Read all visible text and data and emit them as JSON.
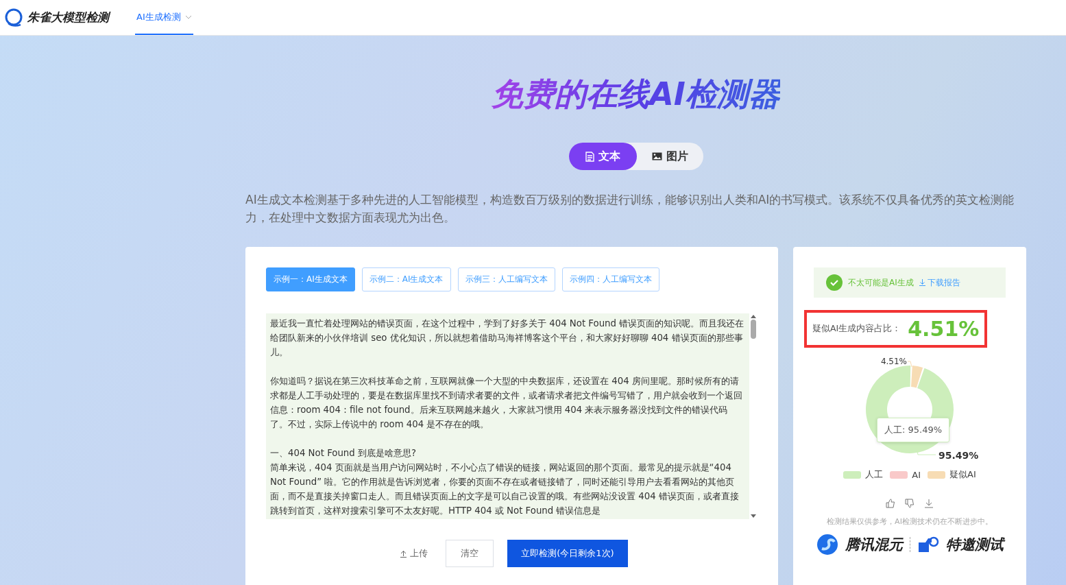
{
  "header": {
    "brand": "朱雀大模型检测",
    "nav": [
      {
        "label": "AI生成检测",
        "selected": true
      }
    ]
  },
  "hero": {
    "title": "免费的在线AI检测器",
    "modes": [
      {
        "label": "文本",
        "kind": "text",
        "selected": true
      },
      {
        "label": "图片",
        "kind": "image",
        "selected": false
      }
    ],
    "description": "AI生成文本检测基于多种先进的人工智能模型，构造数百万级别的数据进行训练，能够识别出人类和AI的书写模式。该系统不仅具备优秀的英文检测能力，在处理中文数据方面表现尤为出色。"
  },
  "editor": {
    "examples": [
      {
        "label": "示例一：AI生成文本",
        "selected": true
      },
      {
        "label": "示例二：AI生成文本",
        "selected": false
      },
      {
        "label": "示例三：人工编写文本",
        "selected": false
      },
      {
        "label": "示例四：人工编写文本",
        "selected": false
      }
    ],
    "paragraphs": [
      "最近我一直忙着处理网站的错误页面，在这个过程中，学到了好多关于 404 Not Found 错误页面的知识呢。而且我还在给团队新来的小伙伴培训 seo 优化知识，所以就想着借助马海祥博客这个平台，和大家好好聊聊 404 错误页面的那些事儿。",
      "你知道吗？据说在第三次科技革命之前，互联网就像一个大型的中央数据库，还设置在 404 房间里呢。那时候所有的请求都是人工手动处理的，要是在数据库里找不到请求者要的文件，或者请求者把文件编号写错了，用户就会收到一个返回信息：room 404 : file not found。后来互联网越来越火，大家就习惯用 404 来表示服务器没找到文件的错误代码了。不过，实际上传说中的 room 404 是不存在的哦。",
      "一、404 Not Found 到底是啥意思?\n简单来说，404 页面就是当用户访问网站时，不小心点了错误的链接，网站返回的那个页面。最常见的提示就是“404 Not Found” 啦。它的作用就是告诉浏览者，你要的页面不存在或者链接错了，同时还能引导用户去看看网站的其他页面，而不是直接关掉窗口走人。而且错误页面上的文字是可以自己设置的哦。有些网站没设置 404 错误页面，或者直接跳转到首页，这样对搜索引擎可不太友好呢。HTTP 404 或 Not Found 错误信息是"
    ],
    "upload": "上传",
    "clear": "清空",
    "submit": "立即检测(今日剩余1次)"
  },
  "result": {
    "verdict": "不太可能是AI生成",
    "download": "下载报告",
    "ratio_label": "疑似AI生成内容占比：",
    "ratio": "4.51%",
    "chart_data": {
      "type": "donut",
      "categories": [
        "人工",
        "AI",
        "疑似AI"
      ],
      "values": [
        95.49,
        0,
        4.51
      ],
      "colors": [
        "#cdeebb",
        "#f9c9c9",
        "#f7dcb4"
      ],
      "value_labels": [
        "95.49%",
        null,
        "4.51%"
      ]
    },
    "tooltip": "人工: 95.49%",
    "disclaimer": "检测结果仅供参考，AI检测技术仍在不断进步中。",
    "partner1": "腾讯混元",
    "partner2": "特邀测试"
  }
}
